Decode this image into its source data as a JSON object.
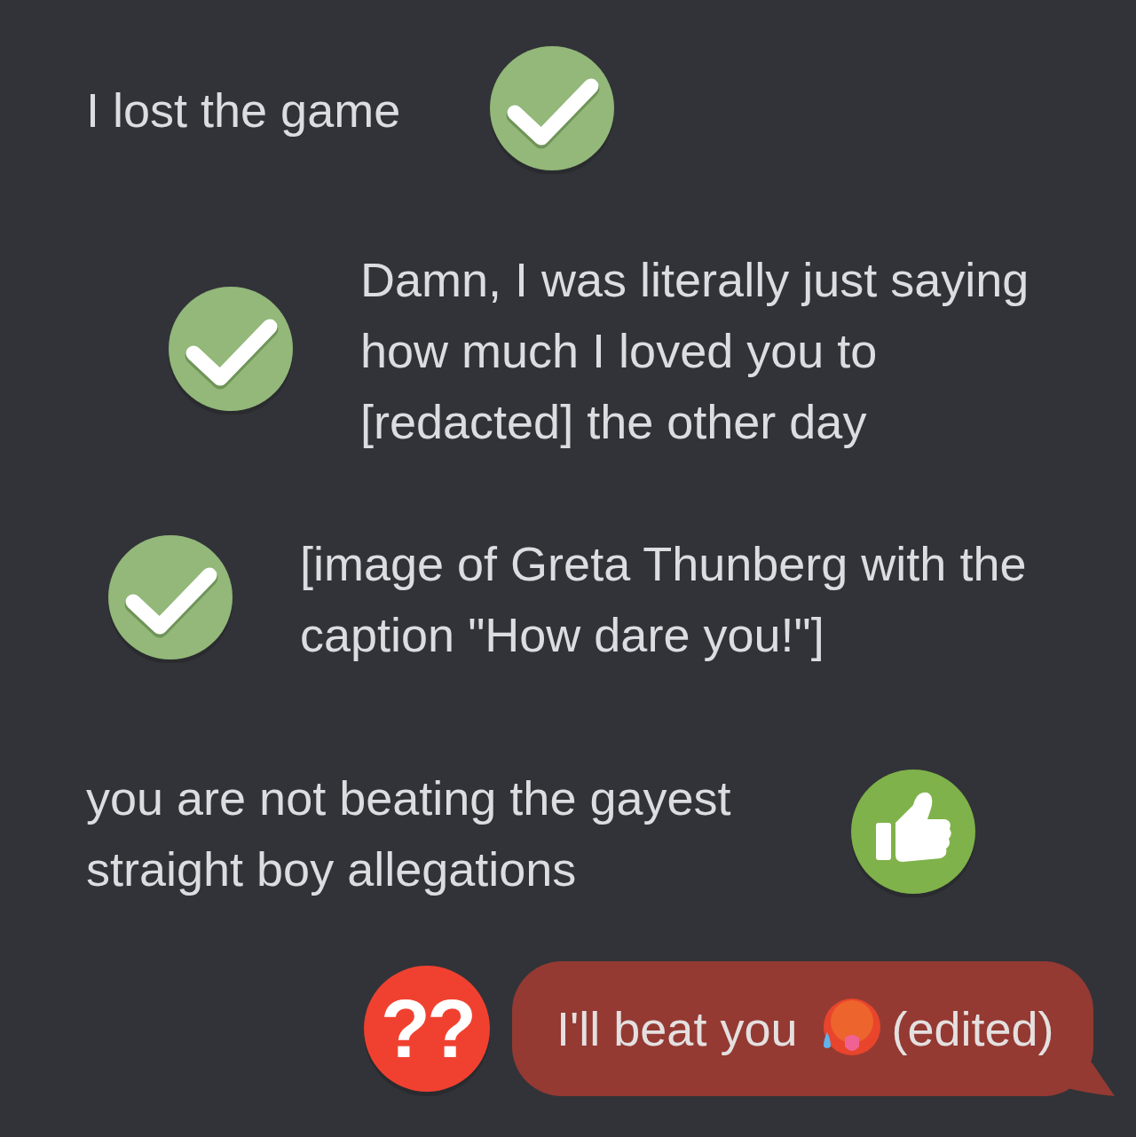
{
  "messages": [
    {
      "kind": "reaction_after",
      "text": "I lost the game",
      "reaction": {
        "kind": "check"
      }
    },
    {
      "kind": "reaction_before",
      "text": "Damn, I was literally just saying how much I loved you to [redacted] the other day",
      "reaction": {
        "kind": "check"
      }
    },
    {
      "kind": "reaction_before",
      "text": "[image of Greta Thunberg with the caption \"How dare you!\"]",
      "reaction": {
        "kind": "check"
      }
    },
    {
      "kind": "reaction_after",
      "text": "you are not beating the gayest straight boy allegations",
      "reaction": {
        "kind": "thumbs_up"
      }
    },
    {
      "kind": "bubble",
      "text": "I'll beat you",
      "suffix": "(edited)",
      "reaction": {
        "kind": "question",
        "label": "??"
      }
    }
  ]
}
